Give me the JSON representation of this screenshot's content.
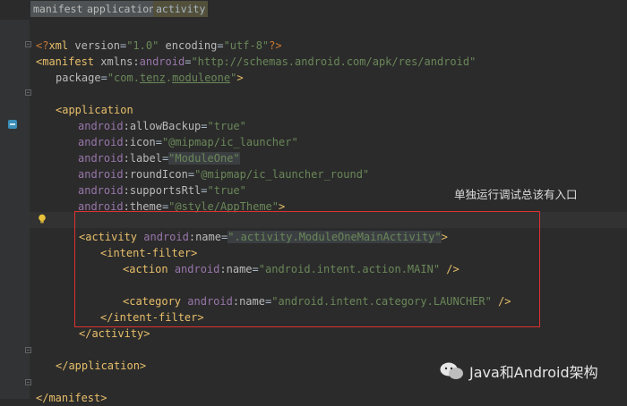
{
  "breadcrumbs": [
    {
      "label": "manifest"
    },
    {
      "label": "application"
    },
    {
      "label": "activity"
    }
  ],
  "code": {
    "l1": {
      "pi_open": "<?",
      "name": "xml",
      "attr1": "version",
      "val1": "\"1.0\"",
      "attr2": "encoding",
      "val2": "\"utf-8\"",
      "pi_close": "?>"
    },
    "l2": {
      "tag": "<manifest",
      "attr_prefix": "xmlns:",
      "attr_ns": "android",
      "eq": "=",
      "val": "\"http://schemas.android.com/apk/res/android\""
    },
    "l3": {
      "attr": "package",
      "eq": "=",
      "val_pre": "\"com.",
      "val_u1": "tenz",
      "val_dot": ".",
      "val_u2": "moduleone",
      "val_post": "\"",
      "close": ">"
    },
    "l5": {
      "tag": "<application"
    },
    "l6": {
      "ns": "android",
      "colon": ":",
      "attr": "allowBackup",
      "eq": "=",
      "val": "\"true\""
    },
    "l7": {
      "ns": "android",
      "colon": ":",
      "attr": "icon",
      "eq": "=",
      "val": "\"@mipmap/ic_launcher\""
    },
    "l8": {
      "ns": "android",
      "colon": ":",
      "attr": "label",
      "eq": "=",
      "val": "\"ModuleOne\""
    },
    "l9": {
      "ns": "android",
      "colon": ":",
      "attr": "roundIcon",
      "eq": "=",
      "val": "\"@mipmap/ic_launcher_round\""
    },
    "l10": {
      "ns": "android",
      "colon": ":",
      "attr": "supportsRtl",
      "eq": "=",
      "val": "\"true\""
    },
    "l11": {
      "ns": "android",
      "colon": ":",
      "attr": "theme",
      "eq": "=",
      "val": "\"@style/AppTheme\"",
      "close": ">"
    },
    "l13": {
      "tag": "<activity",
      "ns": "android",
      "colon": ":",
      "attr": "name",
      "eq": "=",
      "val": "\".activity.ModuleOneMainActivity\"",
      "close": ">"
    },
    "l14": {
      "tag": "<intent-filter>"
    },
    "l15": {
      "tag": "<action",
      "ns": "android",
      "colon": ":",
      "attr": "name",
      "eq": "=",
      "val": "\"android.intent.action.MAIN\"",
      "close": " />"
    },
    "l17": {
      "tag": "<category",
      "ns": "android",
      "colon": ":",
      "attr": "name",
      "eq": "=",
      "val": "\"android.intent.category.LAUNCHER\"",
      "close": " />"
    },
    "l18": {
      "tag": "</intent-filter>"
    },
    "l19": {
      "tag": "</activity>"
    },
    "l21": {
      "tag": "</application>"
    },
    "l23": {
      "tag": "</manifest>"
    }
  },
  "annotation": {
    "text": "单独运行调试总该有入口"
  },
  "watermark": {
    "text": "Java和Android架构"
  },
  "colors": {
    "background": "#2b2b2b",
    "tag": "#e8bf6a",
    "string": "#6a8759",
    "namespace": "#9876aa",
    "highlight_box": "#e03030"
  },
  "icons": {
    "bulb": "lightbulb-icon",
    "gutter": "android-icon",
    "watermark": "wechat-icon"
  }
}
